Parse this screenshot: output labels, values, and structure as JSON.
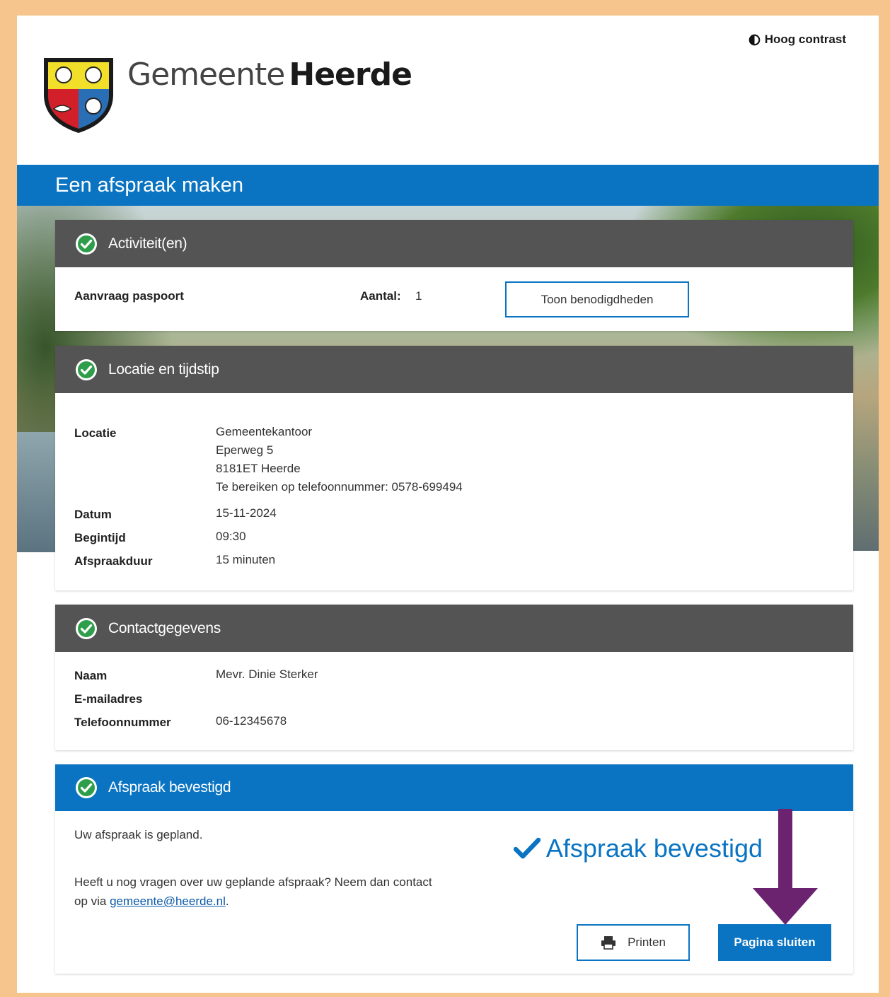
{
  "header": {
    "contrast_label": "Hoog contrast",
    "brand_light": "Gemeente",
    "brand_bold": "Heerde"
  },
  "page_title": "Een afspraak maken",
  "activities": {
    "title": "Activiteit(en)",
    "item_name": "Aanvraag paspoort",
    "count_label": "Aantal:",
    "count_value": "1",
    "requirements_button": "Toon benodigdheden"
  },
  "location": {
    "title": "Locatie en tijdstip",
    "location_label": "Locatie",
    "location_lines": [
      "Gemeentekantoor",
      "Eperweg 5",
      "8181ET Heerde",
      "Te bereiken op telefoonnummer: 0578-699494"
    ],
    "date_label": "Datum",
    "date_value": "15-11-2024",
    "start_label": "Begintijd",
    "start_value": "09:30",
    "duration_label": "Afspraakduur",
    "duration_value": "15 minuten"
  },
  "contact": {
    "title": "Contactgegevens",
    "name_label": "Naam",
    "name_value": "Mevr. Dinie Sterker",
    "email_label": "E-mailadres",
    "email_value": "",
    "phone_label": "Telefoonnummer",
    "phone_value": "06-12345678"
  },
  "confirmation": {
    "title": "Afspraak bevestigd",
    "planned_text": "Uw afspraak is gepland.",
    "question_line1": "Heeft u nog vragen over uw geplande afspraak? Neem dan contact",
    "question_prefix": "op via ",
    "email_link": "gemeente@heerde.nl",
    "question_suffix": ".",
    "confirmed_label": "Afspraak bevestigd",
    "print_button": "Printen",
    "close_button": "Pagina sluiten"
  },
  "colors": {
    "accent_blue": "#0a74c2",
    "section_header_gray": "#545454",
    "frame_orange": "#f6c48d",
    "annotation_arrow": "#6b2370"
  }
}
